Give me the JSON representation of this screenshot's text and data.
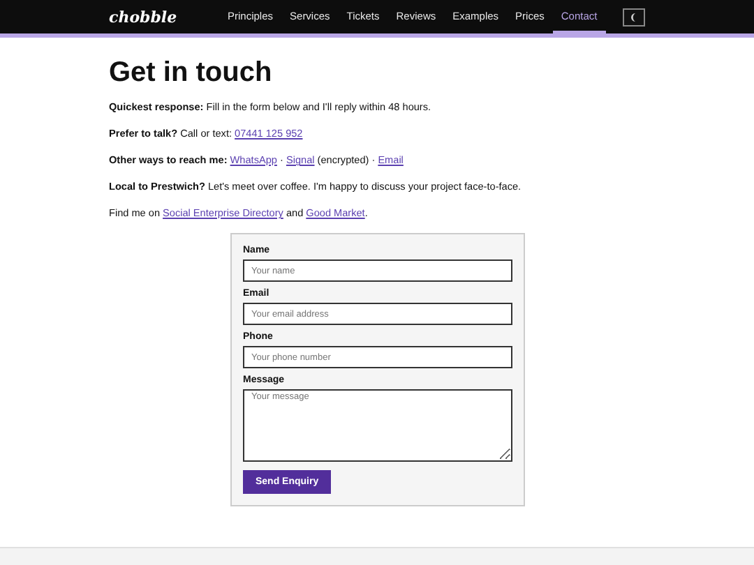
{
  "nav": {
    "logo": "chobble",
    "items": [
      {
        "label": "Principles",
        "selected": false
      },
      {
        "label": "Services",
        "selected": false
      },
      {
        "label": "Tickets",
        "selected": false
      },
      {
        "label": "Reviews",
        "selected": false
      },
      {
        "label": "Examples",
        "selected": false
      },
      {
        "label": "Prices",
        "selected": false
      },
      {
        "label": "Contact",
        "selected": true
      }
    ]
  },
  "heading": "Get in touch",
  "paragraphs": [
    [
      {
        "kind": "bold",
        "text": "Quickest response:"
      },
      {
        "kind": "plain",
        "text": " Fill in the form below and I'll reply within 48 hours."
      }
    ],
    [
      {
        "kind": "bold",
        "text": "Prefer to talk?"
      },
      {
        "kind": "plain",
        "text": " Call or text: "
      },
      {
        "kind": "link",
        "text": "07441 125 952"
      }
    ],
    [
      {
        "kind": "bold",
        "text": "Other ways to reach me: "
      },
      {
        "kind": "link",
        "text": "WhatsApp"
      },
      {
        "kind": "plain",
        "text": " · "
      },
      {
        "kind": "link",
        "text": "Signal"
      },
      {
        "kind": "plain",
        "text": " (encrypted) · "
      },
      {
        "kind": "link",
        "text": "Email"
      }
    ],
    [
      {
        "kind": "bold",
        "text": "Local to Prestwich?"
      },
      {
        "kind": "plain",
        "text": " Let's meet over coffee. I'm happy to discuss your project face-to-face."
      }
    ],
    [
      {
        "kind": "plain",
        "text": "Find me on "
      },
      {
        "kind": "link",
        "text": "Social Enterprise Directory"
      },
      {
        "kind": "plain",
        "text": " and "
      },
      {
        "kind": "link",
        "text": "Good Market"
      },
      {
        "kind": "plain",
        "text": "."
      }
    ]
  ],
  "form": {
    "fields": [
      {
        "label": "Name",
        "placeholder": "Your name",
        "kind": "input"
      },
      {
        "label": "Email",
        "placeholder": "Your email address",
        "kind": "input"
      },
      {
        "label": "Phone",
        "placeholder": "Your phone number",
        "kind": "input"
      },
      {
        "label": "Message",
        "placeholder": "Your message",
        "kind": "textarea"
      }
    ],
    "submit": "Send Enquiry"
  }
}
